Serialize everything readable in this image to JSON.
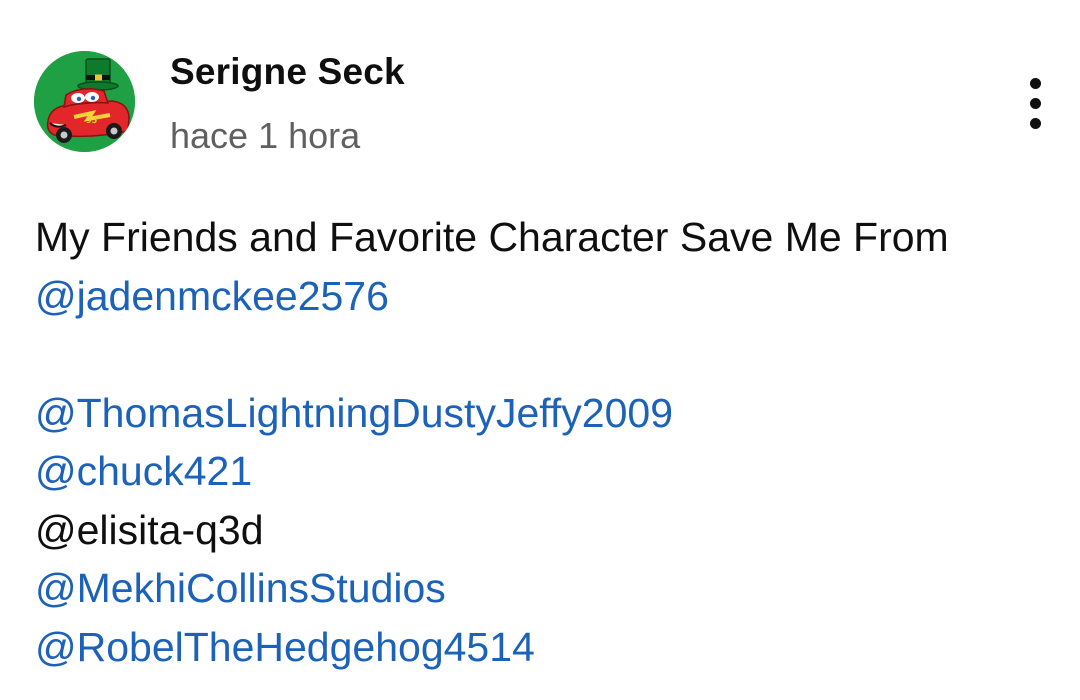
{
  "comment": {
    "author": "Serigne Seck",
    "timestamp": "hace 1 hora",
    "avatar_icon": "leprechaun-race-car-icon",
    "menu_icon": "more-vertical-icon",
    "text_line_1": "My Friends and Favorite Character Save Me From",
    "mentions": [
      "@jadenmckee2576",
      "@ThomasLightningDustyJeffy2009",
      "@chuck421",
      "@elisita-q3d",
      "@MekhiCollinsStudios",
      "@RobelTheHedgehog4514"
    ]
  },
  "colors": {
    "link": "#1c62b9",
    "text": "#0f0f0f",
    "secondary_text": "#606060",
    "avatar_bg": "#1fa044"
  }
}
